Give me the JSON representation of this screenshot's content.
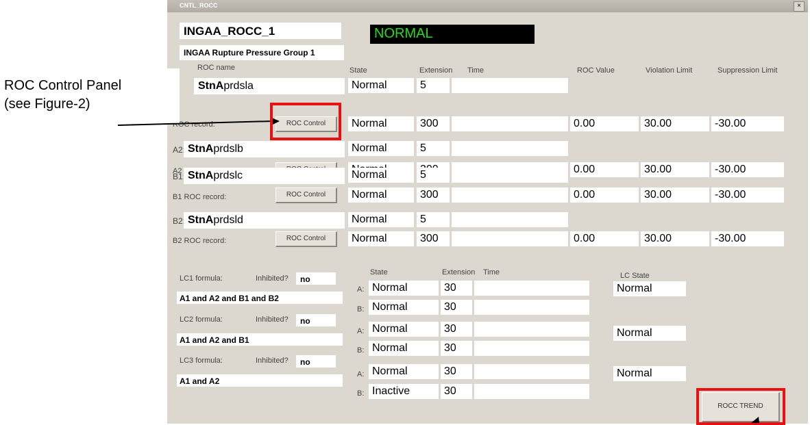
{
  "window": {
    "title": "CNTL_ROCC",
    "close": "×"
  },
  "header": {
    "group_id": "INGAA_ROCC_1",
    "status": "NORMAL",
    "group_name": "INGAA Rupture Pressure Group 1"
  },
  "columns": {
    "roc_name": "ROC name",
    "state": "State",
    "extension": "Extension",
    "time": "Time",
    "roc_value": "ROC Value",
    "violation_limit": "Violation Limit",
    "suppression_limit": "Suppression Limit"
  },
  "rocs": [
    {
      "tag": "",
      "name_bold": "StnA",
      "name_rest": "prdsla",
      "state": "Normal",
      "extension": "5",
      "time": "",
      "record_label": "ROC record:",
      "button": "ROC Control",
      "rec_state": "Normal",
      "rec_extension": "300",
      "rec_time": "",
      "roc_value": "0.00",
      "violation": "30.00",
      "suppression": "-30.00"
    },
    {
      "tag": "A2:",
      "name_bold": "StnA",
      "name_rest": "prdslb",
      "state": "Normal",
      "extension": "5",
      "time": "",
      "record_label": "A2 ROC record:",
      "button": "ROC Control",
      "rec_state": "Normal",
      "rec_extension": "300",
      "rec_time": "",
      "roc_value": "0.00",
      "violation": "30.00",
      "suppression": "-30.00"
    },
    {
      "tag": "B1:",
      "name_bold": "StnA",
      "name_rest": "prdslc",
      "state": "Normal",
      "extension": "5",
      "time": "",
      "record_label": "B1 ROC record:",
      "button": "ROC Control",
      "rec_state": "Normal",
      "rec_extension": "300",
      "rec_time": "",
      "roc_value": "0.00",
      "violation": "30.00",
      "suppression": "-30.00"
    },
    {
      "tag": "B2:",
      "name_bold": "StnA",
      "name_rest": "prdsld",
      "state": "Normal",
      "extension": "5",
      "time": "",
      "record_label": "B2 ROC record:",
      "button": "ROC Control",
      "rec_state": "Normal",
      "rec_extension": "300",
      "rec_time": "",
      "roc_value": "0.00",
      "violation": "30.00",
      "suppression": "-30.00"
    }
  ],
  "lc_headers": {
    "state": "State",
    "extension": "Extension",
    "time": "Time",
    "lc_state": "LC State"
  },
  "lcs": [
    {
      "label": "LC1 formula:",
      "inhibited_label": "Inhibited?",
      "inhibited": "no",
      "formula": "A1 and A2 and B1 and B2",
      "a_label": "A:",
      "a_state": "Normal",
      "a_ext": "30",
      "b_label": "B:",
      "b_state": "Normal",
      "b_ext": "30",
      "lc_state": "Normal"
    },
    {
      "label": "LC2 formula:",
      "inhibited_label": "Inhibited?",
      "inhibited": "no",
      "formula": "A1 and A2 and B1",
      "a_label": "A:",
      "a_state": "Normal",
      "a_ext": "30",
      "b_label": "B:",
      "b_state": "Normal",
      "b_ext": "30",
      "lc_state": "Normal"
    },
    {
      "label": "LC3 formula:",
      "inhibited_label": "Inhibited?",
      "inhibited": "no",
      "formula": "A1 and A2",
      "a_label": "A:",
      "a_state": "Normal",
      "a_ext": "30",
      "b_label": "B:",
      "b_state": "Inactive",
      "b_ext": "30",
      "lc_state": "Normal"
    }
  ],
  "trend_button": "ROCC TREND",
  "annotation": {
    "line1": "ROC Control Panel",
    "line2": "(see Figure-2)"
  },
  "colors": {
    "highlight": "#e81010",
    "status_text": "#22dd22",
    "status_bg": "#000000"
  }
}
